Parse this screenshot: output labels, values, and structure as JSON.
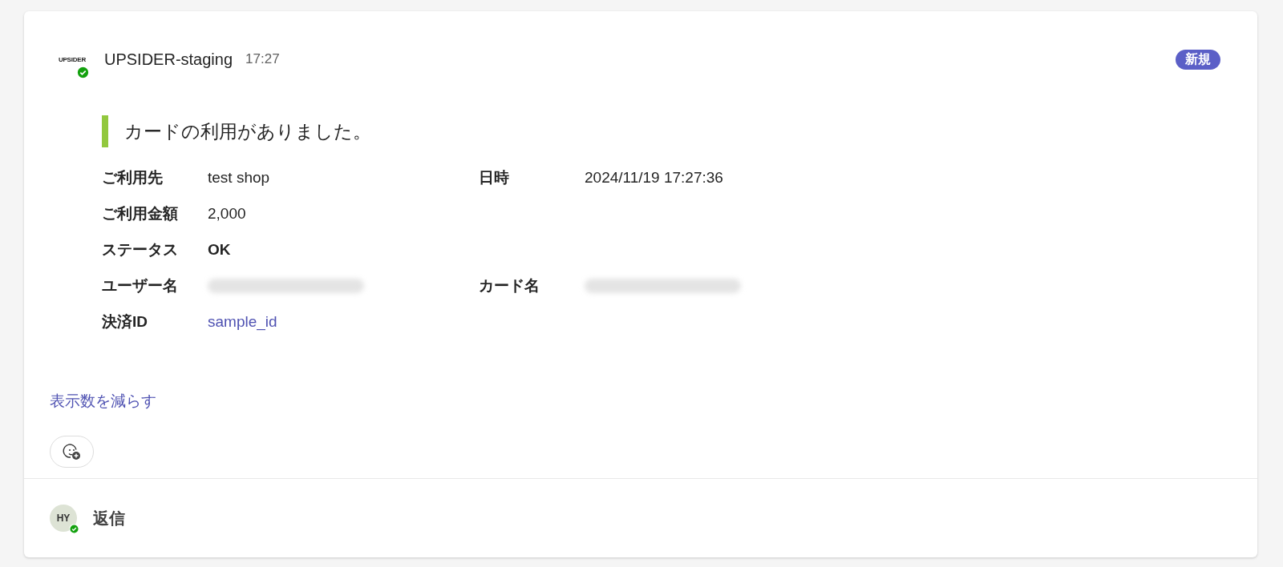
{
  "message": {
    "sender": "UPSIDER-staging",
    "logo": "UPSIDER",
    "verified": true,
    "time": "17:27",
    "badge": "新規",
    "title": "カードの利用がありました。",
    "fields": [
      {
        "label": "ご利用先",
        "value": "test shop",
        "kind": "text"
      },
      {
        "label": "日時",
        "value": "2024/11/19 17:27:36",
        "kind": "text"
      },
      {
        "label": "ご利用金額",
        "value": "2,000",
        "kind": "text"
      },
      {
        "label": "ステータス",
        "value": "OK",
        "kind": "bold"
      },
      {
        "label": "ユーザー名",
        "kind": "blurred"
      },
      {
        "label": "カード名",
        "kind": "blurred"
      },
      {
        "label": "決済ID",
        "value": "sample_id",
        "kind": "link"
      }
    ],
    "collapse_link": "表示数を減らす"
  },
  "reply": {
    "initials": "HY",
    "online": true,
    "label": "返信"
  }
}
